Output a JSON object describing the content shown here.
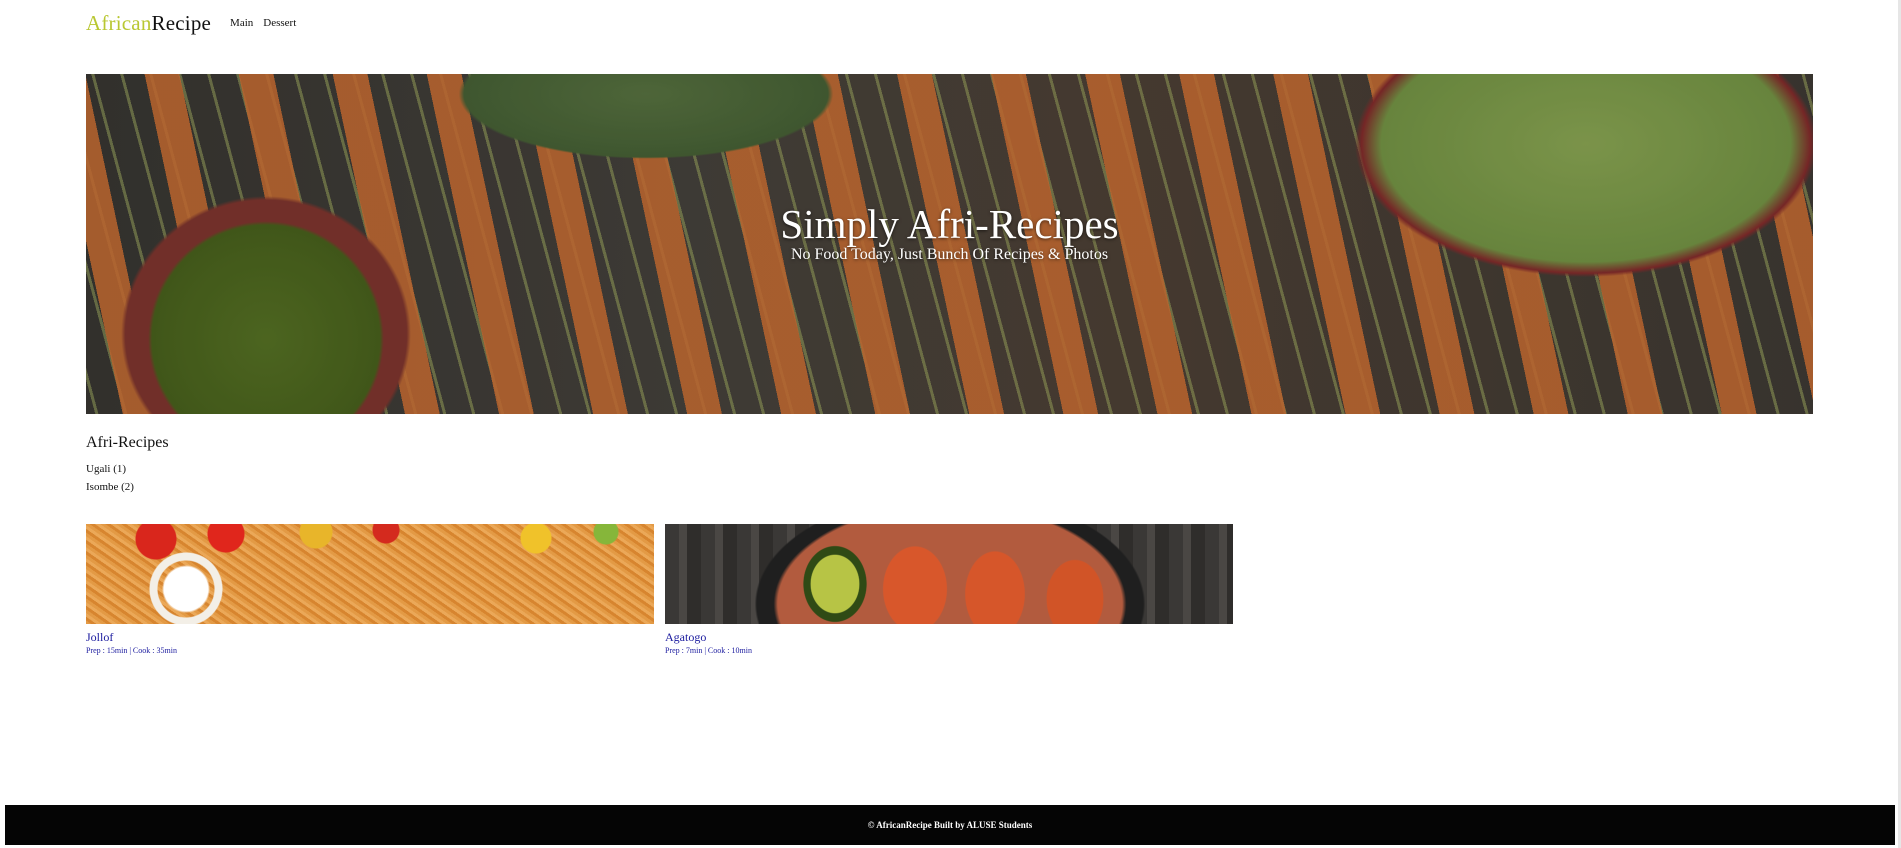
{
  "header": {
    "logo_accent": "African",
    "logo_rest": "Recipe",
    "nav": [
      "Main",
      "Dessert"
    ]
  },
  "hero": {
    "title": "Simply Afri-Recipes",
    "subtitle": "No Food Today, Just Bunch Of Recipes & Photos"
  },
  "recipes_section": {
    "title": "Afri-Recipes",
    "categories": [
      "Ugali (1)",
      "Isombe (2)"
    ]
  },
  "cards": [
    {
      "title": "Jollof",
      "meta": "Prep : 15min | Cook : 35min"
    },
    {
      "title": "Agatogo",
      "meta": "Prep : 7min | Cook : 10min"
    }
  ],
  "footer": {
    "text": "© AfricanRecipe Built by ALUSE Students"
  },
  "colors": {
    "accent": "#b9c732",
    "link": "#1a1a9e",
    "footer_bg": "#050505"
  }
}
